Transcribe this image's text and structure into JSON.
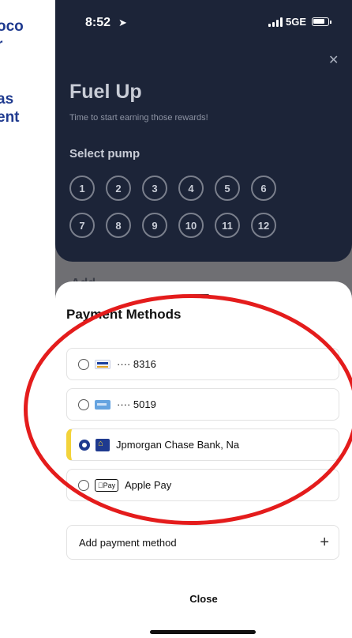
{
  "article": {
    "lines": [
      "oco",
      "r",
      "",
      "l",
      "as",
      "ent"
    ]
  },
  "status_bar": {
    "time": "8:52",
    "network": "5GE"
  },
  "fuel_up": {
    "title": "Fuel Up",
    "subtitle": "Time to start earning those rewards!",
    "select_pump_label": "Select pump",
    "pumps": [
      "1",
      "2",
      "3",
      "4",
      "5",
      "6",
      "7",
      "8",
      "9",
      "10",
      "11",
      "12"
    ],
    "partial_heading": "Add"
  },
  "payment_sheet": {
    "title": "Payment Methods",
    "methods": [
      {
        "label": "···· 8316",
        "icon": "visa-card-icon",
        "selected": false
      },
      {
        "label": "···· 5019",
        "icon": "amex-card-icon",
        "selected": false
      },
      {
        "label": "Jpmorgan Chase Bank, Na",
        "icon": "bank-icon",
        "selected": true
      },
      {
        "label": "Apple Pay",
        "icon": "apple-pay-icon",
        "selected": false
      }
    ],
    "apple_pay_badge": "Pay",
    "add_method_label": "Add payment method",
    "add_icon": "+",
    "close_label": "Close"
  },
  "colors": {
    "accent": "#1f3a8f",
    "selected_bar": "#f3d33a",
    "dark_header": "#1c2438",
    "annotation": "#e41c1c"
  }
}
